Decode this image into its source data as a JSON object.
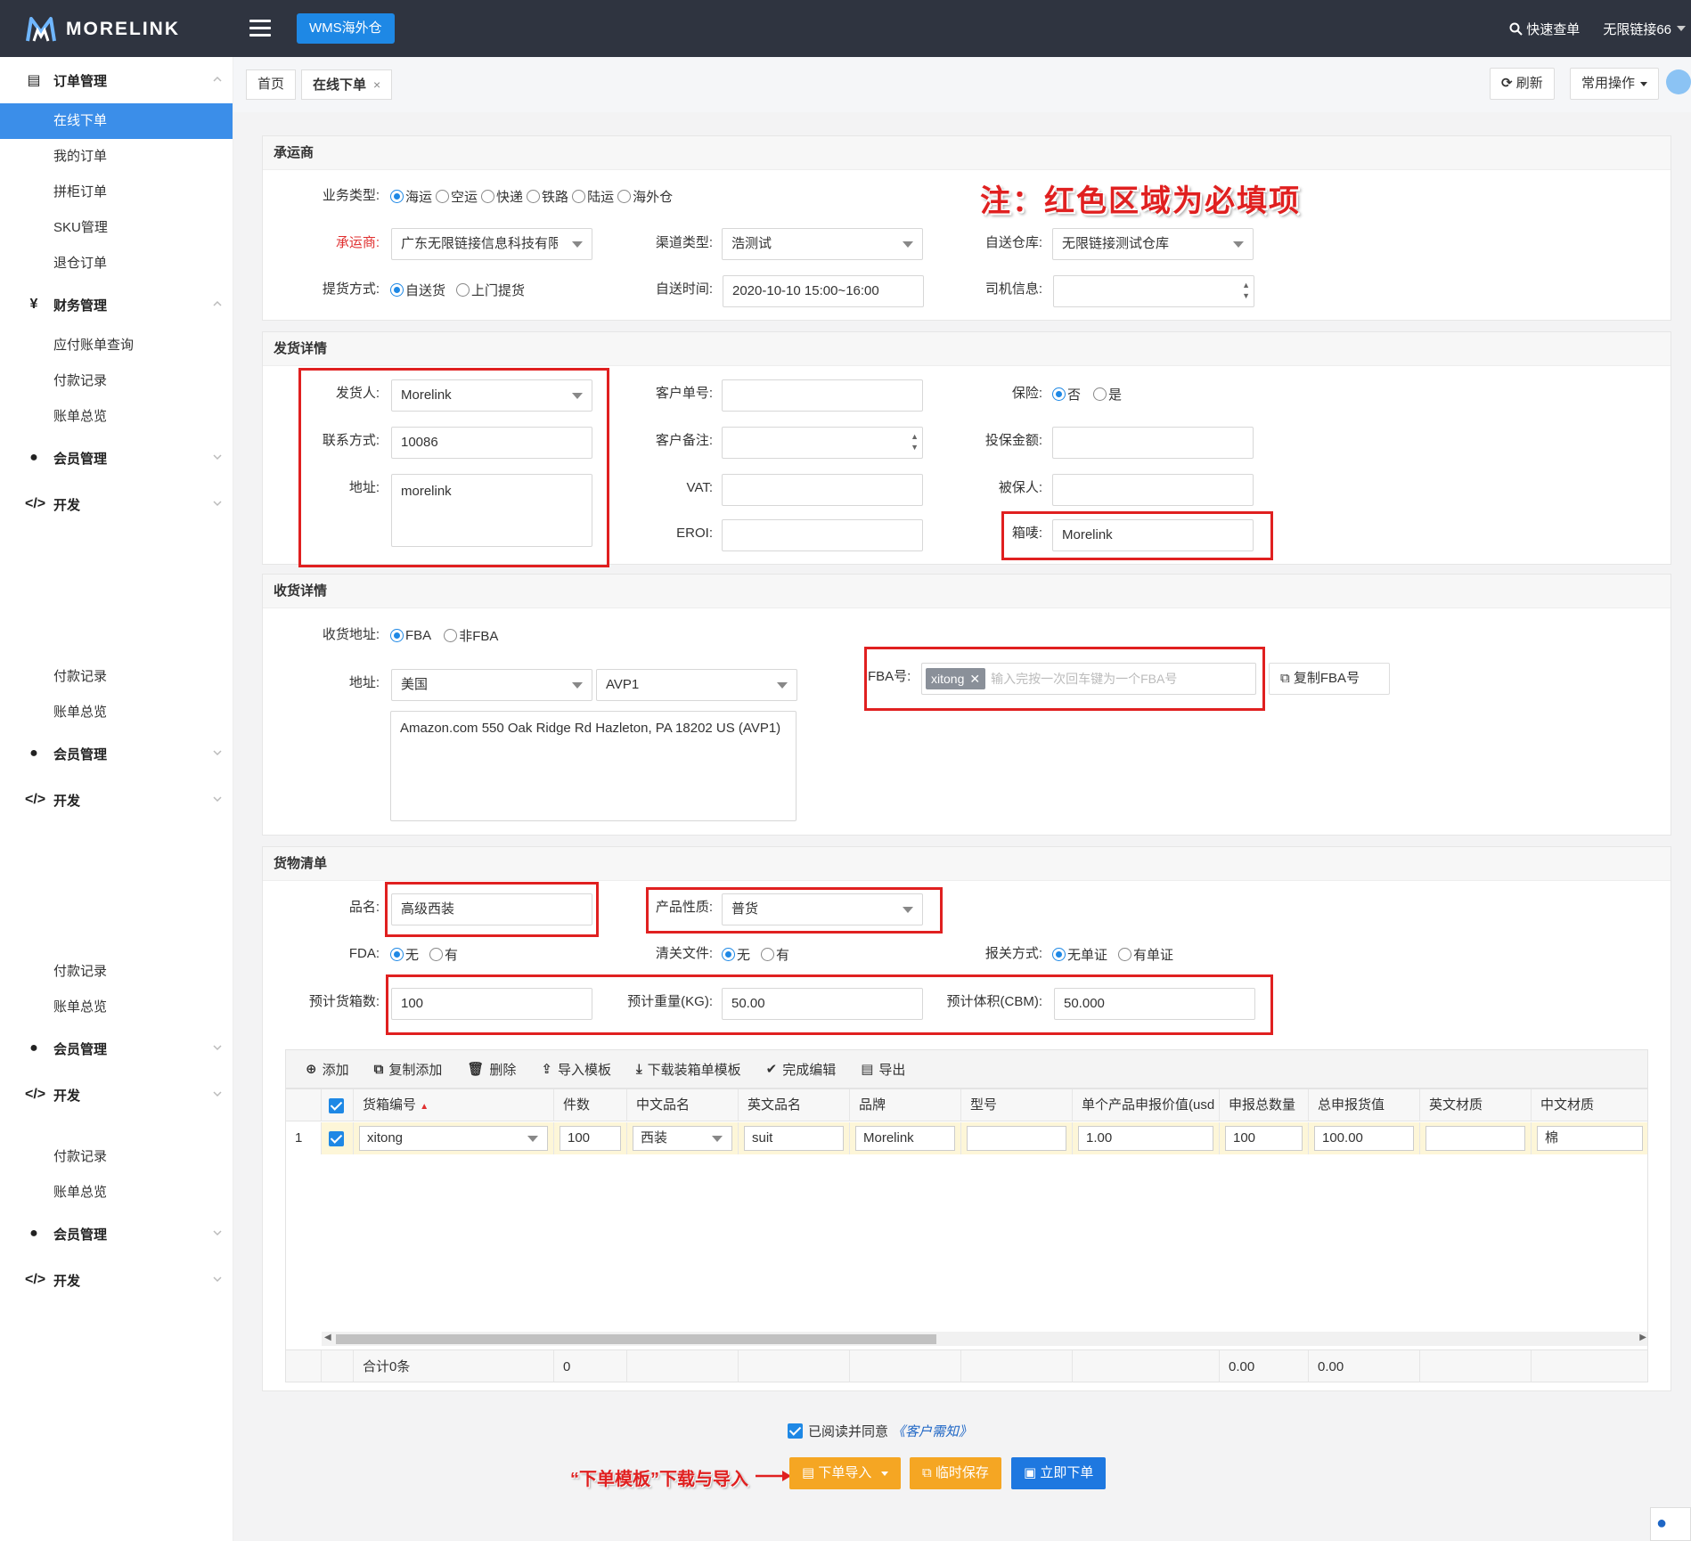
{
  "header": {
    "logo_text": "MORELINK",
    "tab_button": "WMS海外仓",
    "quick_search": "快速查单",
    "user": "无限链接66"
  },
  "sidebar": {
    "groups": [
      {
        "label": "订单管理",
        "icon": "order-icon",
        "items": [
          "在线下单",
          "我的订单",
          "拼柜订单",
          "SKU管理",
          "退仓订单"
        ]
      },
      {
        "label": "财务管理",
        "icon": "yen-icon",
        "items": [
          "应付账单查询",
          "付款记录",
          "账单总览"
        ]
      },
      {
        "label": "会员管理",
        "icon": "user-icon"
      },
      {
        "label": "开发",
        "icon": "code-icon"
      }
    ],
    "repeat_items": [
      "付款记录",
      "账单总览"
    ],
    "repeat_groups": [
      "会员管理",
      "开发"
    ],
    "active_item": "在线下单"
  },
  "tabs": {
    "home": "首页",
    "current": "在线下单",
    "close": "×",
    "refresh": "刷新",
    "common_ops": "常用操作"
  },
  "note": "注：红色区域为必填项",
  "carrier": {
    "title": "承运商",
    "business_type_label": "业务类型:",
    "business_types": [
      "海运",
      "空运",
      "快递",
      "铁路",
      "陆运",
      "海外仓"
    ],
    "business_type_selected": "海运",
    "carrier_label": "承运商:",
    "carrier_value": "广东无限链接信息科技有限",
    "channel_label": "渠道类型:",
    "channel_value": "浩测试",
    "warehouse_label": "自送仓库:",
    "warehouse_value": "无限链接测试仓库",
    "pickup_label": "提货方式:",
    "pickup_options": [
      "自送货",
      "上门提货"
    ],
    "pickup_selected": "自送货",
    "time_label": "自送时间:",
    "time_value": "2020-10-10 15:00~16:00",
    "driver_label": "司机信息:",
    "driver_value": ""
  },
  "shipper": {
    "title": "发货详情",
    "sender_label": "发货人:",
    "sender_value": "Morelink",
    "contact_label": "联系方式:",
    "contact_value": "10086",
    "address_label": "地址:",
    "address_value": "morelink",
    "customer_no_label": "客户单号:",
    "customer_no_value": "",
    "customer_note_label": "客户备注:",
    "customer_note_value": "",
    "vat_label": "VAT:",
    "vat_value": "",
    "eori_label": "EROI:",
    "eori_value": "",
    "insurance_label": "保险:",
    "insurance_options": [
      "否",
      "是"
    ],
    "insurance_selected": "否",
    "insured_amount_label": "投保金额:",
    "insured_amount_value": "",
    "insured_person_label": "被保人:",
    "insured_person_value": "",
    "mark_label": "箱唛:",
    "mark_value": "Morelink"
  },
  "receiver": {
    "title": "收货详情",
    "addr_type_label": "收货地址:",
    "addr_types": [
      "FBA",
      "非FBA"
    ],
    "addr_type_selected": "FBA",
    "address_label": "地址:",
    "country": "美国",
    "warehouse_code": "AVP1",
    "full_address": "Amazon.com 550 Oak Ridge Rd Hazleton, PA 18202  US (AVP1)",
    "fba_label": "FBA号:",
    "fba_tag": "xitong",
    "fba_placeholder": "输入完按一次回车键为一个FBA号",
    "copy_fba": "复制FBA号"
  },
  "goods": {
    "title": "货物清单",
    "name_label": "品名:",
    "name_value": "高级西装",
    "nature_label": "产品性质:",
    "nature_value": "普货",
    "fda_label": "FDA:",
    "fda_options": [
      "无",
      "有"
    ],
    "fda_selected": "无",
    "clearance_label": "清关文件:",
    "clearance_options": [
      "无",
      "有"
    ],
    "clearance_selected": "无",
    "declare_label": "报关方式:",
    "declare_options": [
      "无单证",
      "有单证"
    ],
    "declare_selected": "无单证",
    "boxes_label": "预计货箱数:",
    "boxes_value": "100",
    "weight_label": "预计重量(KG):",
    "weight_value": "50.00",
    "volume_label": "预计体积(CBM):",
    "volume_value": "50.000"
  },
  "toolbar": {
    "add": "添加",
    "copy_add": "复制添加",
    "delete": "删除",
    "import_template": "导入模板",
    "download_template": "下载装箱单模板",
    "finish_edit": "完成编辑",
    "export": "导出"
  },
  "table": {
    "columns": [
      "货箱编号",
      "件数",
      "中文品名",
      "英文品名",
      "品牌",
      "型号",
      "单个产品申报价值(usd",
      "申报总数量",
      "总申报货值",
      "英文材质",
      "中文材质"
    ],
    "row": {
      "index": "1",
      "box_no": "xitong",
      "qty": "100",
      "cn_name": "西装",
      "en_name": "suit",
      "brand": "Morelink",
      "model": "",
      "unit_value": "1.00",
      "total_qty": "100",
      "total_value": "100.00",
      "en_material": "",
      "cn_material": "棉"
    },
    "footer": {
      "total_label": "合计0条",
      "qty_sum": "0",
      "total_qty_sum": "0.00",
      "total_value_sum": "0.00"
    }
  },
  "footer": {
    "agree_text": "已阅读并同意",
    "agree_link": "《客户需知》",
    "annotation": "“下单模板”下载与导入",
    "import_order": "下单导入",
    "temp_save": "临时保存",
    "submit": "立即下单"
  },
  "colors": {
    "topbar": "#2f3440",
    "accent": "#1e88e5",
    "required": "#e02020",
    "orange": "#f5a623"
  }
}
